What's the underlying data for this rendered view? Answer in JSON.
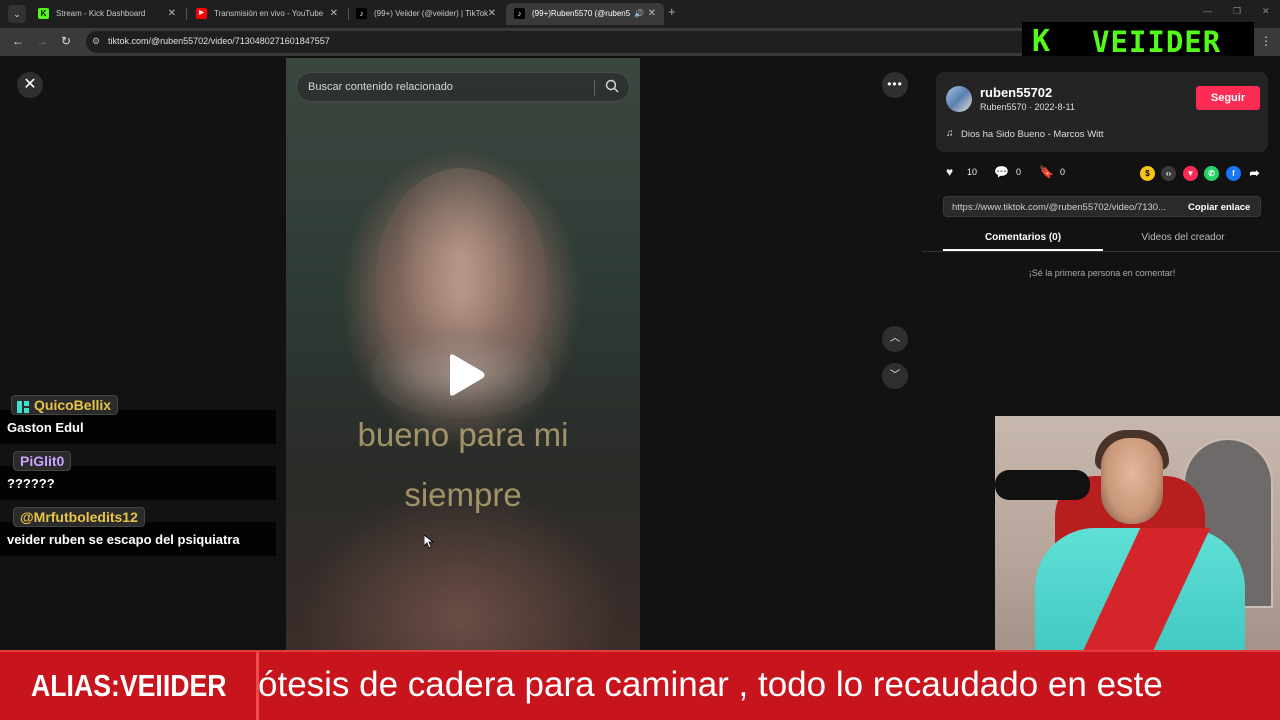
{
  "browser": {
    "tabs": [
      {
        "title": "Stream - Kick Dashboard",
        "favicon": "K",
        "favicon_color": "#53fc18"
      },
      {
        "title": "Transmisión en vivo - YouTube",
        "favicon": "▶",
        "favicon_color": "#ff0000"
      },
      {
        "title": "(99+) Veiider (@veiider) | TikTok",
        "favicon": "♪",
        "favicon_color": "#ffffff"
      },
      {
        "title": "(99+)Ruben5570 (@ruben5",
        "favicon": "♪",
        "favicon_color": "#ffffff"
      }
    ],
    "url": "tiktok.com/@ruben55702/video/7130480271601847557"
  },
  "overlay_logo": {
    "k": "K",
    "name": "VEIIDER",
    "color": "#53fc18"
  },
  "video": {
    "search_placeholder": "Buscar contenido relacionado",
    "caption_line1": "bueno para mi",
    "caption_line2": "siempre"
  },
  "creator": {
    "username": "ruben55702",
    "sub_line": "Ruben5570 · 2022-8-11",
    "follow_label": "Seguir",
    "music": "Dios ha Sido Bueno - Marcos Witt"
  },
  "actions": {
    "likes": "10",
    "comments": "0",
    "saves": "0"
  },
  "share": {
    "link": "https://www.tiktok.com/@ruben55702/video/7130...",
    "copy_label": "Copiar enlace"
  },
  "panel_tabs": {
    "comments": "Comentarios (0)",
    "videos": "Videos del creador"
  },
  "empty_comments": "¡Sé la primera persona en comentar!",
  "chat": [
    {
      "user": "QuicoBellix",
      "user_color": "#e8c547",
      "badge": true,
      "message": "Gaston Edul"
    },
    {
      "user": "PiGlit0",
      "user_color": "#c9a3ff",
      "badge": false,
      "message": "??????"
    },
    {
      "user": "@Mrfutboledits12",
      "user_color": "#e8c547",
      "badge": false,
      "message": "veider ruben se escapo del psiquiatra"
    }
  ],
  "ticker": {
    "alias": "ALIAS:VEIIDER",
    "scroll_text": "ótesis de cadera para caminar , todo lo recaudado en este"
  },
  "colors": {
    "accent": "#fe2c55",
    "ticker_bg": "#c8141d",
    "kick_green": "#53fc18"
  }
}
